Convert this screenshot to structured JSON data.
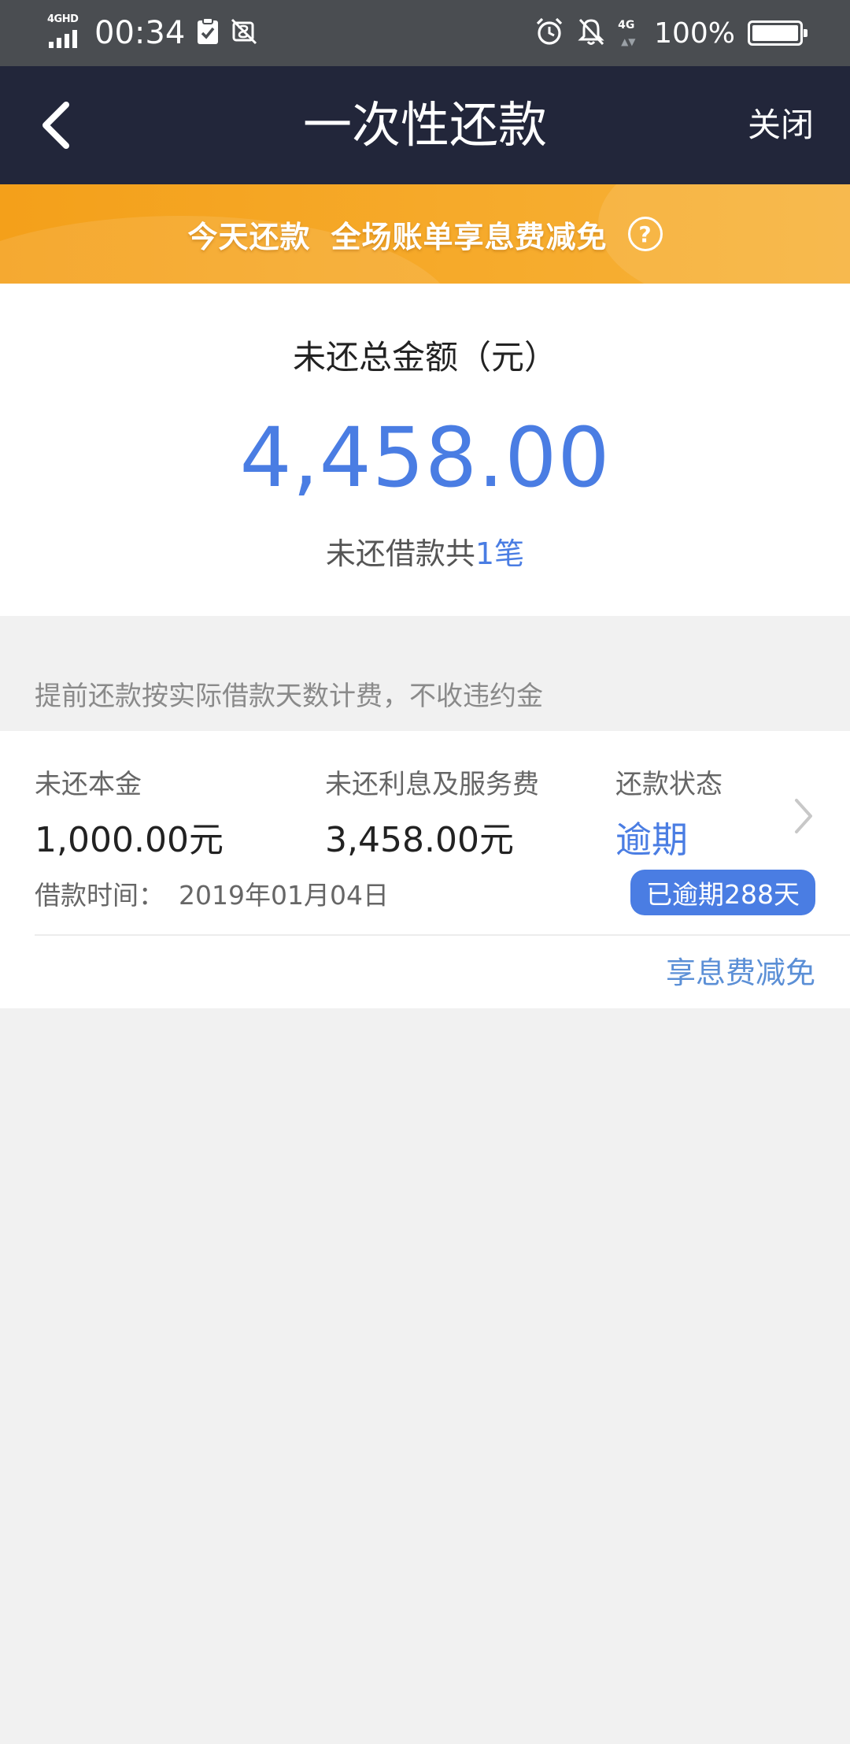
{
  "status_bar": {
    "network_label": "4GHD",
    "time": "00:34",
    "net_4g": "4G",
    "battery_pct": "100%",
    "battery_level": 1.0
  },
  "nav": {
    "title": "一次性还款",
    "close_label": "关闭"
  },
  "promo": {
    "part1": "今天还款",
    "part2": "全场账单享息费减免",
    "help_glyph": "?"
  },
  "summary": {
    "label": "未还总金额（元）",
    "amount": "4,458.00",
    "count_prefix": "未还借款共",
    "count_value": "1笔"
  },
  "notice": "提前还款按实际借款天数计费，不收违约金",
  "loan": {
    "principal_label": "未还本金",
    "principal_value": "1,000.00元",
    "interest_label": "未还利息及服务费",
    "interest_value": "3,458.00元",
    "status_label": "还款状态",
    "status_value": "逾期",
    "date_label": "借款时间：",
    "date_value": "2019年01月04日",
    "overdue_badge": "已逾期288天",
    "waiver_link": "享息费减免"
  },
  "colors": {
    "nav_bg": "#22263a",
    "accent_blue": "#4a7de3",
    "promo_orange": "#f4a01a"
  }
}
